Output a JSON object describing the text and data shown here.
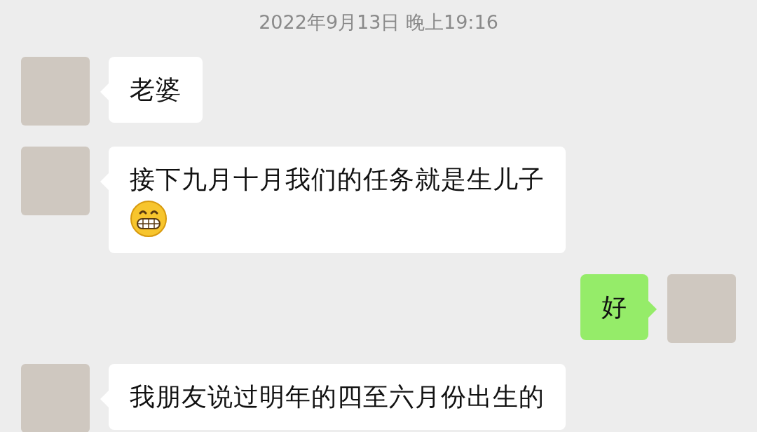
{
  "timestamp": "2022年9月13日 晚上19:16",
  "messages": [
    {
      "kind": "received",
      "text": "老婆",
      "emoji": false
    },
    {
      "kind": "received",
      "text": "接下九月十月我们的任务就是生儿子",
      "emoji": true
    },
    {
      "kind": "sent",
      "text": "好",
      "emoji": false
    },
    {
      "kind": "received",
      "text": "我朋友说过明年的四至六月份出生的",
      "emoji": false
    }
  ]
}
